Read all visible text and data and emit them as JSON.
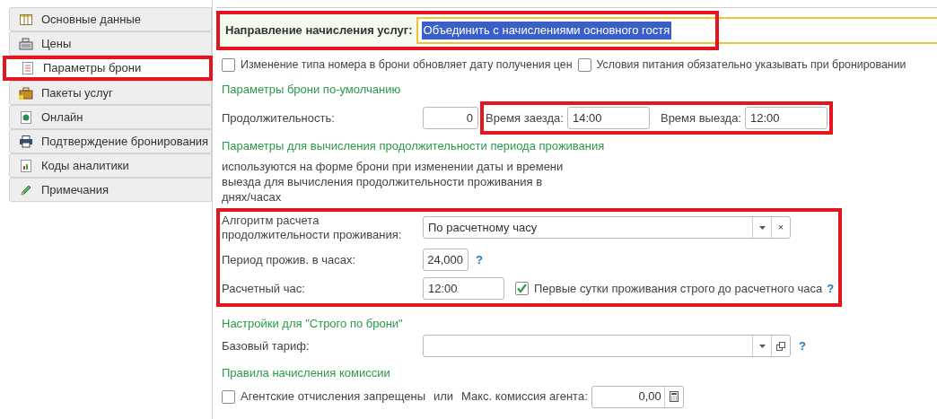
{
  "sidebar": {
    "items": [
      {
        "label": "Основные данные",
        "selected": false
      },
      {
        "label": "Цены",
        "selected": false
      },
      {
        "label": "Параметры брони",
        "selected": true
      },
      {
        "label": "Пакеты услуг",
        "selected": false
      },
      {
        "label": "Онлайн",
        "selected": false
      },
      {
        "label": "Подтверждение бронирования",
        "selected": false
      },
      {
        "label": "Коды аналитики",
        "selected": false
      },
      {
        "label": "Примечания",
        "selected": false
      }
    ]
  },
  "service_direction": {
    "label": "Направление начисления услуг:",
    "value": "Объединить с начислениями основного гостя"
  },
  "options": [
    {
      "label": "Изменение типа номера в брони обновляет дату получения цен",
      "checked": false
    },
    {
      "label": "Условия питания обязательно указывать при бронировании",
      "checked": false
    }
  ],
  "defaults": {
    "title": "Параметры брони по-умолчанию",
    "duration": {
      "label": "Продолжительность:",
      "value": "0"
    },
    "checkin": {
      "label": "Время заезда:",
      "value": "14:00"
    },
    "checkout": {
      "label": "Время выезда:",
      "value": "12:00"
    }
  },
  "period": {
    "title": "Параметры для вычисления продолжительности периода проживания",
    "note": "используются на форме брони при изменении даты и времени выезда для вычисления продолжительности проживания в днях/часах",
    "algorithm": {
      "label": "Алгоритм расчета продолжительности проживания:",
      "value": "По расчетному часу",
      "clear": "×"
    },
    "hours": {
      "label": "Период прожив. в часах:",
      "value": "24,000",
      "help": "?"
    },
    "calc_hour": {
      "label": "Расчетный час:",
      "value": "12:00"
    },
    "first_day": {
      "label": "Первые сутки проживания строго до расчетного часа",
      "checked": true,
      "help": "?"
    }
  },
  "strict": {
    "title": "Настройки для \"Строго по брони\"",
    "base_rate": {
      "label": "Базовый тариф:",
      "help": "?"
    }
  },
  "commission": {
    "title": "Правила начисления комиссии",
    "agent_forbidden": {
      "label": "Агентские отчисления запрещены",
      "checked": false
    },
    "or_text": "или",
    "max": {
      "label": "Макс. комиссия агента:",
      "value": "0,00"
    }
  }
}
